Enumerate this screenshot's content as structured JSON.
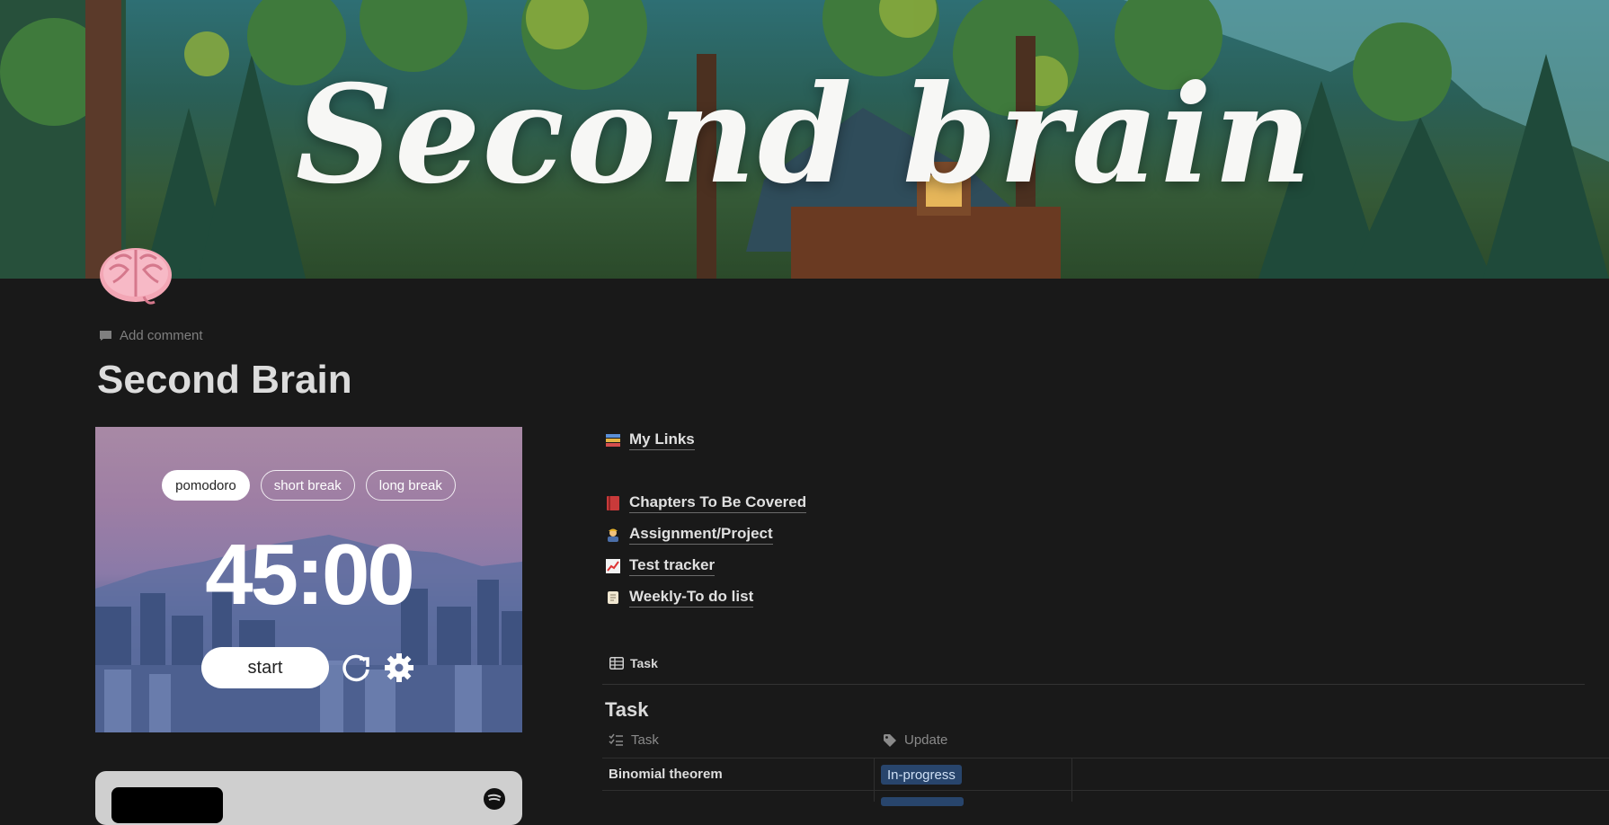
{
  "banner": {
    "title": "Second brain"
  },
  "page": {
    "add_comment": "Add comment",
    "title": "Second Brain"
  },
  "pomodoro": {
    "tabs": [
      "pomodoro",
      "short break",
      "long break"
    ],
    "active_tab": "pomodoro",
    "time": "45:00",
    "start_label": "start"
  },
  "links": [
    {
      "label": "My Links",
      "icon": "books-icon"
    },
    {
      "label": "Chapters To Be Covered",
      "icon": "red-book-icon"
    },
    {
      "label": "Assignment/Project",
      "icon": "worker-icon"
    },
    {
      "label": "Test tracker",
      "icon": "chart-up-icon"
    },
    {
      "label": "Weekly-To do list",
      "icon": "scroll-icon"
    }
  ],
  "database": {
    "view_tab": "Task",
    "title": "Task",
    "columns": [
      {
        "label": "Task",
        "icon": "checklist-icon"
      },
      {
        "label": "Update",
        "icon": "tag-icon"
      }
    ],
    "rows": [
      {
        "task": "Binomial theorem",
        "update": "In-progress"
      },
      {
        "task": "",
        "update": ""
      }
    ]
  },
  "colors": {
    "background": "#191919",
    "status_tag": "#28456c"
  }
}
